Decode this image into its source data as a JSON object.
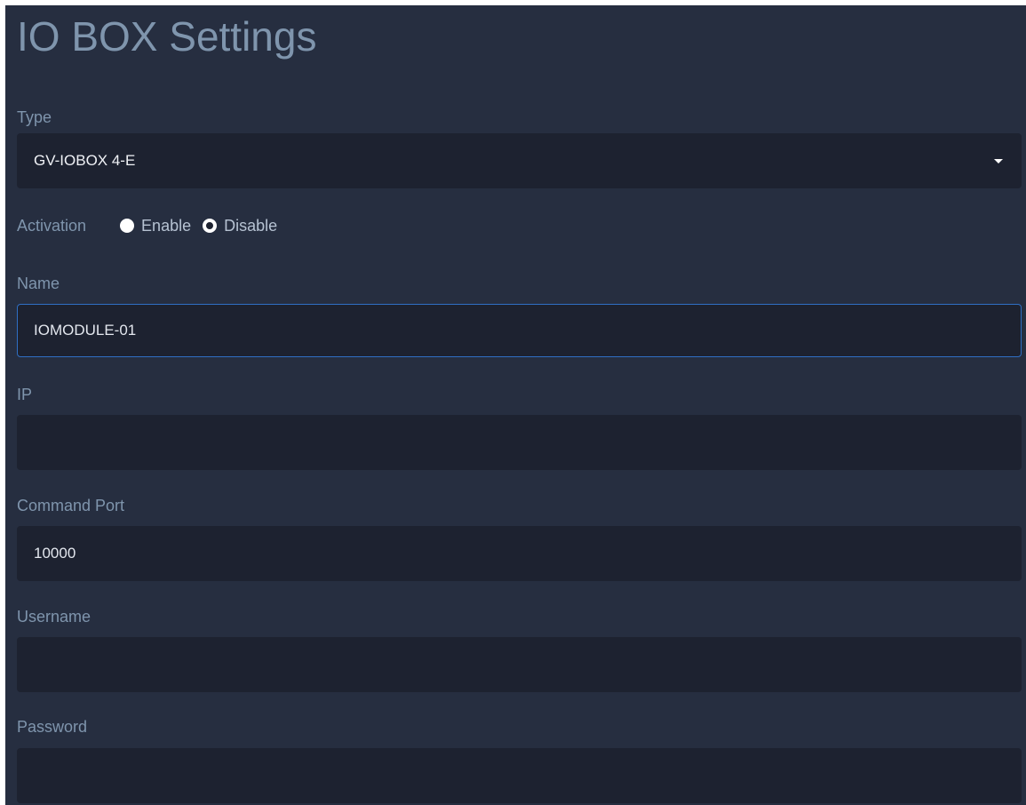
{
  "page": {
    "title": "IO BOX Settings"
  },
  "type_field": {
    "label": "Type",
    "selected_value": "GV-IOBOX 4-E"
  },
  "activation": {
    "label": "Activation",
    "options": [
      {
        "label": "Enable",
        "checked": false
      },
      {
        "label": "Disable",
        "checked": true
      }
    ]
  },
  "name_field": {
    "label": "Name",
    "value": "IOMODULE-01",
    "focused": true
  },
  "ip_field": {
    "label": "IP",
    "value": ""
  },
  "command_port_field": {
    "label": "Command Port",
    "value": "10000"
  },
  "username_field": {
    "label": "Username",
    "value": ""
  },
  "password_field": {
    "label": "Password",
    "value": ""
  },
  "colors": {
    "panel_background": "#262e40",
    "input_background": "#1d2230",
    "label_text": "#7f95ad",
    "focus_border": "#2f6fc4"
  },
  "icons": {
    "type_dropdown": "chevron-down-icon"
  }
}
